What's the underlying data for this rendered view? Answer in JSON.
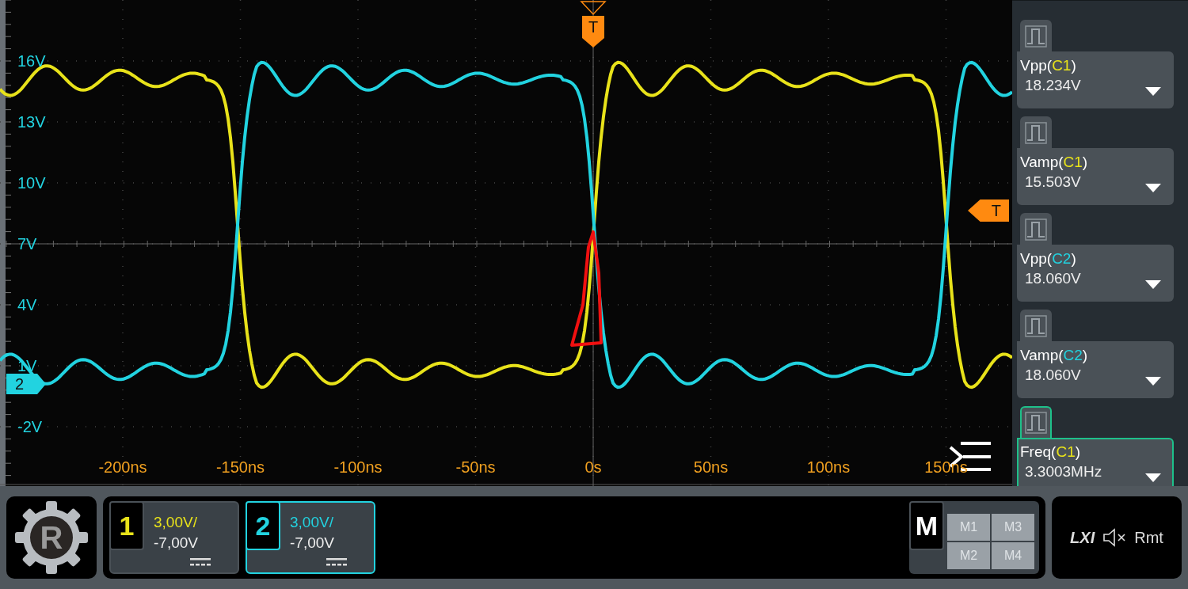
{
  "y_axis": {
    "labels": [
      "16V",
      "13V",
      "10V",
      "7V",
      "4V",
      "1V",
      "-2V"
    ]
  },
  "x_axis": {
    "labels": [
      "-200ns",
      "-150ns",
      "-100ns",
      "-50ns",
      "0s",
      "50ns",
      "100ns",
      "150ns"
    ]
  },
  "markers": {
    "trigger_position": "T",
    "trigger_level": "T",
    "channel_2": "2"
  },
  "measurements": [
    {
      "name": "Vpp(",
      "source": "C1",
      "close": ")",
      "value": "18.234V",
      "color": "#e8e21a",
      "selected": false
    },
    {
      "name": "Vamp(",
      "source": "C1",
      "close": ")",
      "value": "15.503V",
      "color": "#e8e21a",
      "selected": false
    },
    {
      "name": "Vpp(",
      "source": "C2",
      "close": ")",
      "value": "18.060V",
      "color": "#22d3e0",
      "selected": false
    },
    {
      "name": "Vamp(",
      "source": "C2",
      "close": ")",
      "value": "18.060V",
      "color": "#22d3e0",
      "selected": false
    },
    {
      "name": "Freq(",
      "source": "C1",
      "close": ")",
      "value": "3.3003MHz",
      "color": "#e8e21a",
      "selected": true
    }
  ],
  "logo": {
    "letter": "R"
  },
  "channels": [
    {
      "number": "1",
      "scale": "3,00V/",
      "offset": "-7,00V",
      "color": "#e8e21a",
      "selected": false
    },
    {
      "number": "2",
      "scale": "3,00V/",
      "offset": "-7,00V",
      "color": "#22d3e0",
      "selected": true
    }
  ],
  "math": {
    "label": "M",
    "buttons": [
      "M1",
      "M3",
      "M2",
      "M4"
    ]
  },
  "status": {
    "lxi": "LXI",
    "remote": "Rmt"
  }
}
